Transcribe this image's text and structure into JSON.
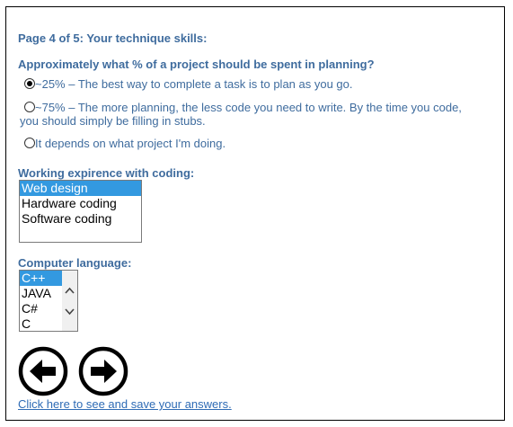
{
  "page": {
    "title": "Page 4 of 5: Your technique skills:"
  },
  "question": {
    "title": "Approximately what % of a project should be spent in planning?",
    "options": [
      {
        "label": "~25% – The best way to complete a task is to plan as you go.",
        "checked": true
      },
      {
        "label_line1": "~75% – The more planning, the less code you need to write. By the time you code,",
        "label_line2": "you should simply be filling in stubs.",
        "checked": false
      },
      {
        "label": "It depends on what project I'm doing.",
        "checked": false
      }
    ]
  },
  "coding": {
    "label": "Working expirence with coding:",
    "items": [
      {
        "label": "Web design",
        "selected": true
      },
      {
        "label": "Hardware coding",
        "selected": false
      },
      {
        "label": "Software coding",
        "selected": false
      }
    ]
  },
  "language": {
    "label": "Computer language:",
    "items": [
      {
        "label": "C++",
        "selected": true
      },
      {
        "label": "JAVA",
        "selected": false
      },
      {
        "label": "C#",
        "selected": false
      },
      {
        "label": "C",
        "selected": false
      }
    ]
  },
  "navigation": {
    "prev_icon": "arrow-left-circle-icon",
    "next_icon": "arrow-right-circle-icon"
  },
  "save_link": "Click here to see and save your answers.",
  "colors": {
    "heading": "#3f6c9e",
    "selection": "#3399e0",
    "link": "#2e6bb5"
  }
}
